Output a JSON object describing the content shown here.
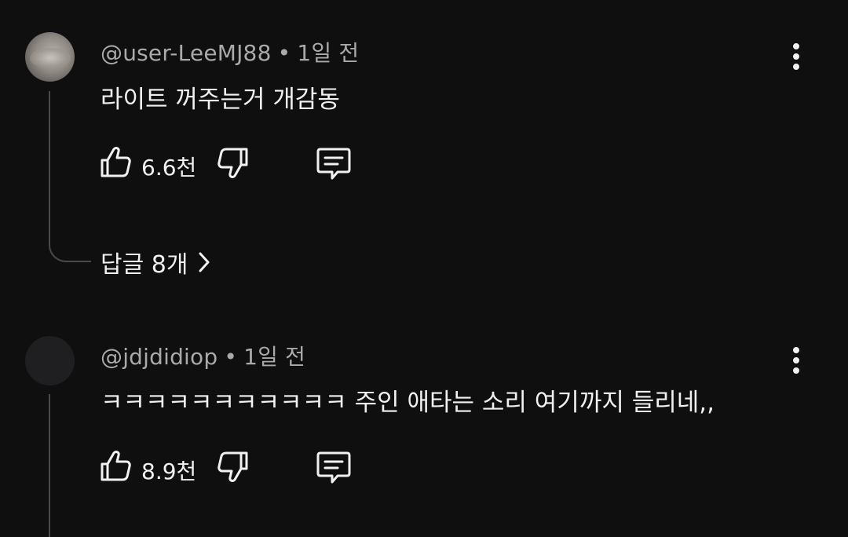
{
  "comments": [
    {
      "author": "@user-LeeMJ88",
      "separator": "•",
      "time": "1일 전",
      "text": "라이트 꺼주는거 개감동",
      "likes": "6.6천",
      "replies_label": "답글 8개"
    },
    {
      "author": "@jdjdidiop",
      "separator": "•",
      "time": "1일 전",
      "text": "ㅋㅋㅋㅋㅋㅋㅋㅋㅋㅋㅋ 주인 애타는 소리 여기까지 들리네,,",
      "likes": "8.9천"
    }
  ],
  "icons": {
    "like": "thumbs-up-icon",
    "dislike": "thumbs-down-icon",
    "reply": "comment-reply-icon",
    "more": "more-vertical-icon",
    "chevron": "chevron-right-icon"
  },
  "colors": {
    "background": "#0f0f0f",
    "text_primary": "#f1f1f1",
    "text_secondary": "#aaaaaa",
    "thread_line": "#4a4a4a"
  }
}
